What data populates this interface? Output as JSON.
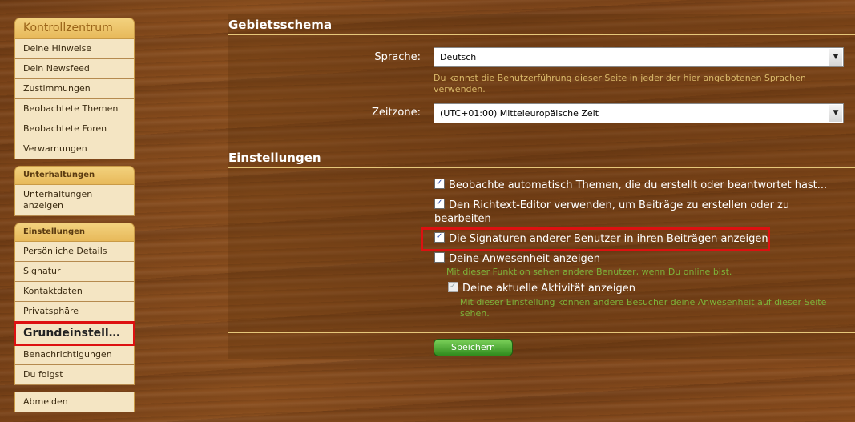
{
  "sidebar": {
    "control_center": {
      "title": "Kontrollzentrum",
      "items": [
        "Deine Hinweise",
        "Dein Newsfeed",
        "Zustimmungen",
        "Beobachtete Themen",
        "Beobachtete Foren",
        "Verwarnungen"
      ]
    },
    "conversations": {
      "title": "Unterhaltungen",
      "items": [
        "Unterhaltungen anzeigen"
      ]
    },
    "settings": {
      "title": "Einstellungen",
      "items": [
        "Persönliche Details",
        "Signatur",
        "Kontaktdaten",
        "Privatsphäre",
        "Grundeinstellun...",
        "Benachrichtigungen",
        "Du folgst"
      ]
    },
    "logout": "Abmelden"
  },
  "locale_section": {
    "title": "Gebietsschema",
    "language_label": "Sprache:",
    "language_value": "Deutsch",
    "language_hint": "Du kannst die Benutzerführung dieser Seite in jeder der hier angebotenen Sprachen verwenden.",
    "timezone_label": "Zeitzone:",
    "timezone_value": "(UTC+01:00) Mitteleuropäische Zeit"
  },
  "settings_section": {
    "title": "Einstellungen",
    "options": [
      {
        "label": "Beobachte automatisch Themen, die du erstellt oder beantwortet hast...",
        "checked": true
      },
      {
        "label": "Den Richtext-Editor verwenden, um Beiträge zu erstellen oder zu bearbeiten",
        "checked": true
      },
      {
        "label": "Die Signaturen anderer Benutzer in ihren Beiträgen anzeigen",
        "checked": true
      },
      {
        "label": "Deine Anwesenheit anzeigen",
        "checked": false,
        "hint": "Mit dieser Funktion sehen andere Benutzer, wenn Du online bist."
      },
      {
        "label": "Deine aktuelle Aktivität anzeigen",
        "checked": true,
        "hint": "Mit dieser Einstellung können andere Besucher deine Anwesenheit auf dieser Seite sehen."
      }
    ]
  },
  "save_button": "Speichern",
  "colors": {
    "accent_red": "#dd1111",
    "save_green": "#3a9a22",
    "hint_gold": "#d9b96a",
    "hint_green": "#7db33a"
  }
}
